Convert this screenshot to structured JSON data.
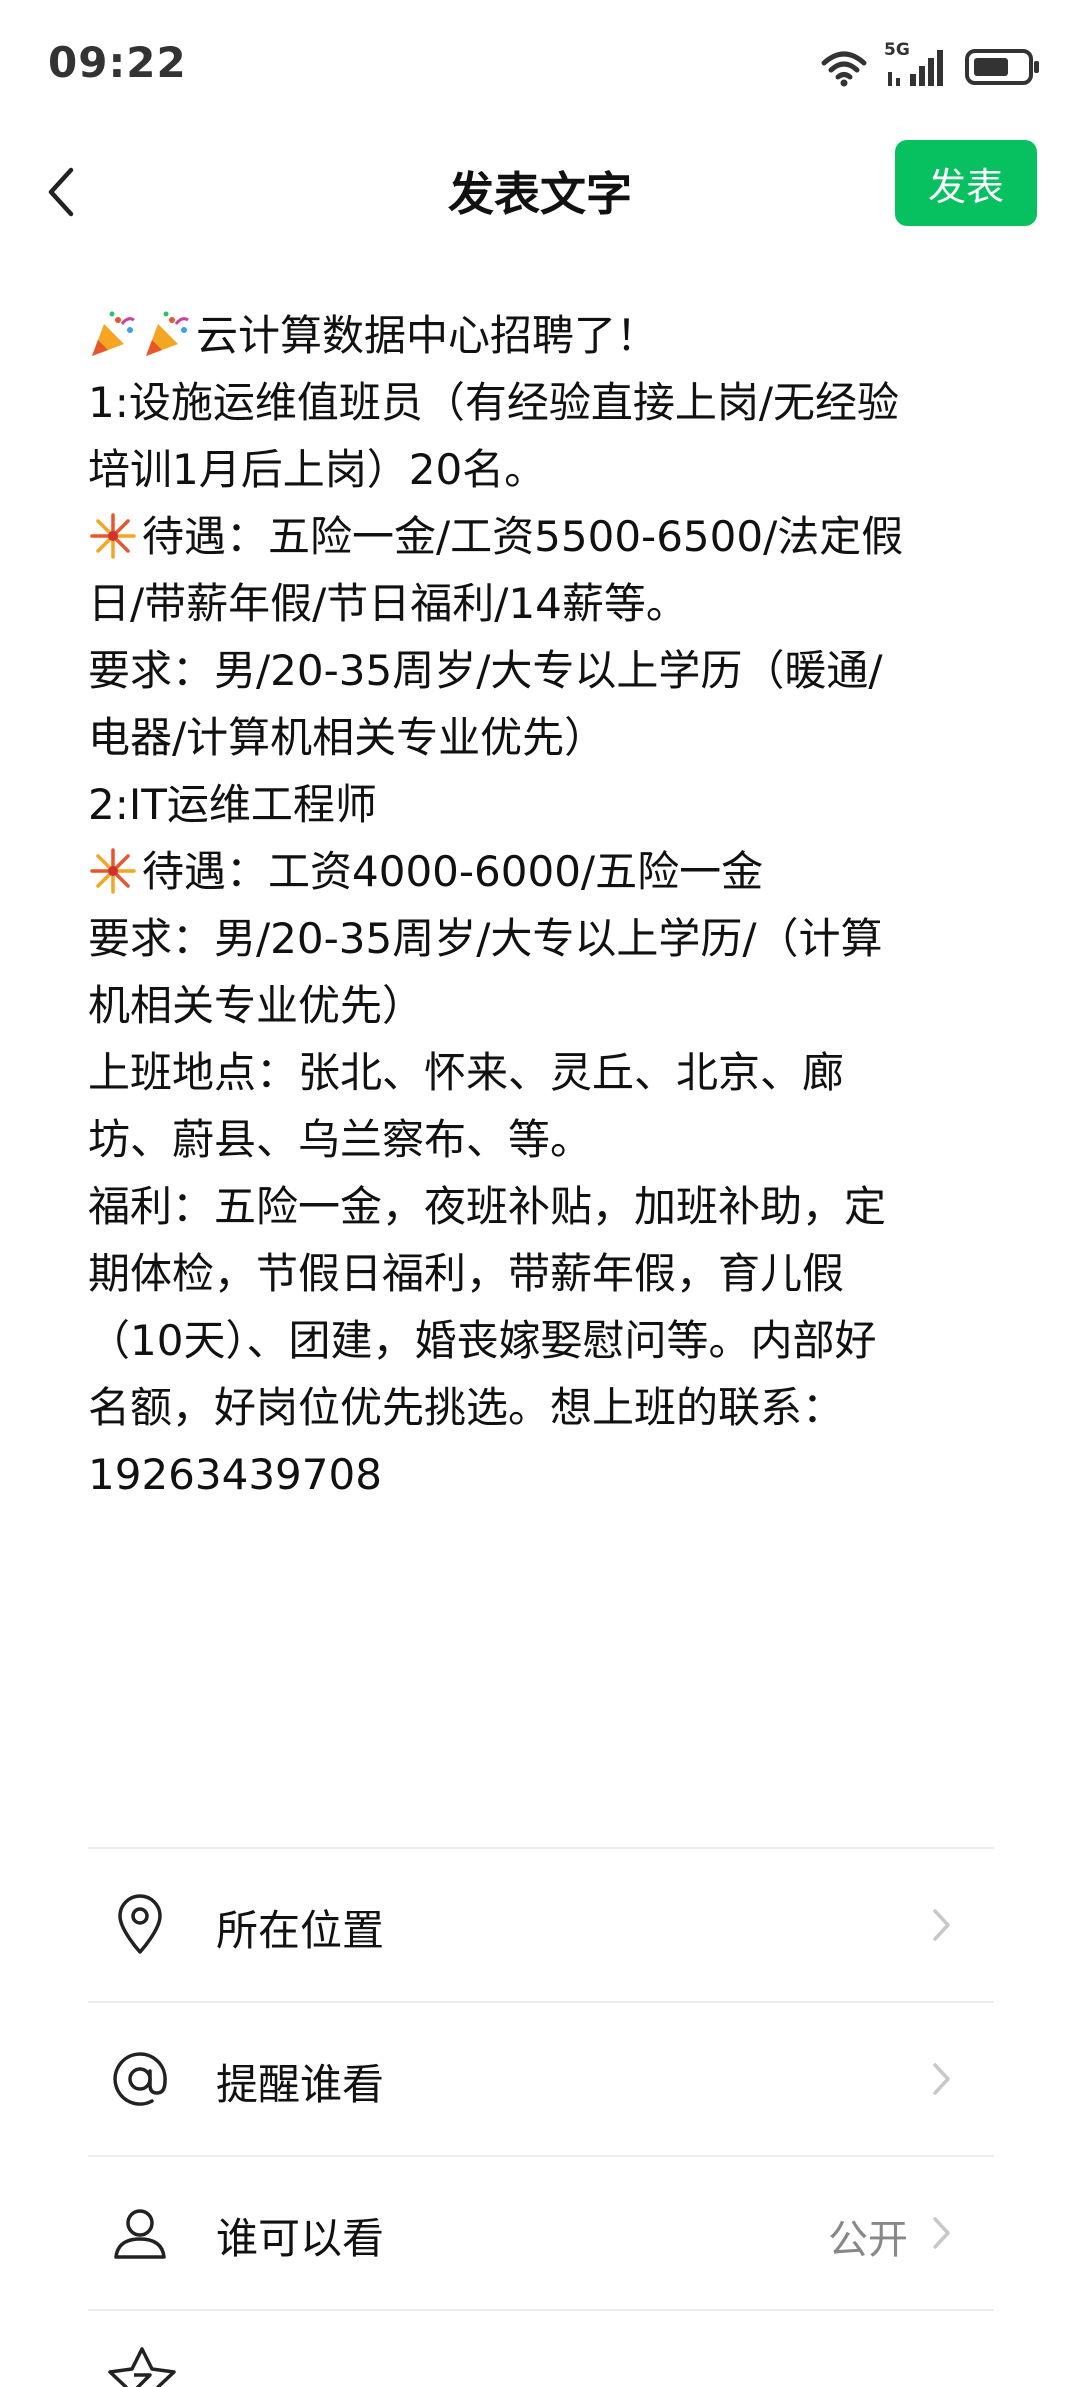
{
  "status_bar": {
    "time": "09:22",
    "network": "5G",
    "icons": [
      "wifi-icon",
      "signal-icon",
      "battery-icon"
    ]
  },
  "header": {
    "title": "发表文字",
    "publish_label": "发表",
    "back_icon": "chevron-left-icon"
  },
  "post": {
    "lines": [
      "云计算数据中心招聘了！",
      "1:设施运维值班员（有经验直接上岗/无经验",
      "培训1月后上岗）20名。",
      "待遇：五险一金/工资5500-6500/法定假",
      "日/带薪年假/节日福利/14薪等。",
      "要求：男/20-35周岁/大专以上学历（暖通/",
      "电器/计算机相关专业优先）",
      "2:IT运维工程师",
      "待遇：工资4000-6000/五险一金",
      "要求：男/20-35周岁/大专以上学历/（计算",
      "机相关专业优先）",
      "上班地点：张北、怀来、灵丘、北京、廊",
      "坊、蔚县、乌兰察布、等。",
      "福利：五险一金，夜班补贴，加班补助，定",
      "期体检，节假日福利，带薪年假，育儿假",
      "（10天）、团建，婚丧嫁娶慰问等。内部好",
      "名额，好岗位优先挑选。想上班的联系：",
      "19263439708"
    ],
    "emojis": [
      "party-popper-icon",
      "fireworks-icon"
    ]
  },
  "options": {
    "location_label": "所在位置",
    "mention_label": "提醒谁看",
    "visibility_label": "谁可以看",
    "visibility_value": "公开"
  },
  "colors": {
    "accent": "#07c160",
    "divider": "#ededed",
    "secondary_text": "#888888"
  }
}
